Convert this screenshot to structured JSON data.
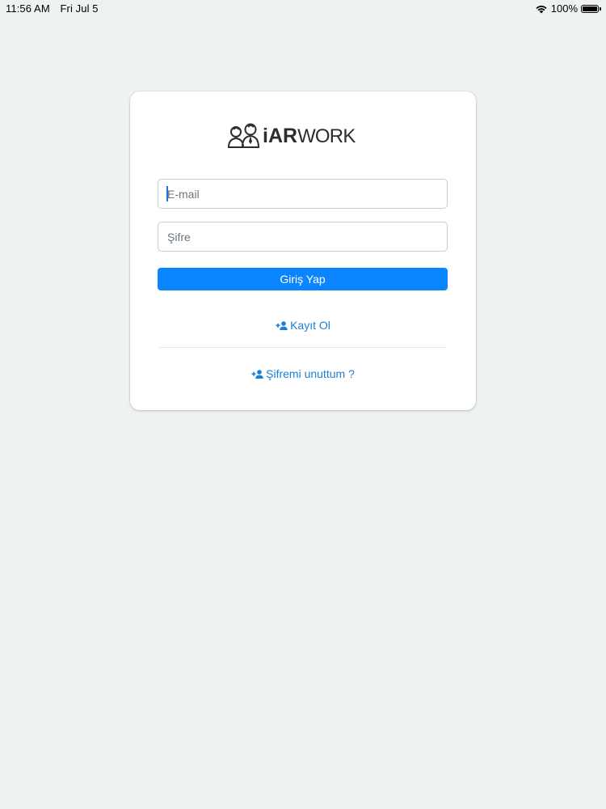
{
  "status_bar": {
    "time": "11:56 AM",
    "date": "Fri Jul 5",
    "battery": "100%"
  },
  "logo": {
    "text_bold": "iAR",
    "text_light": "WORK"
  },
  "form": {
    "email_placeholder": "E-mail",
    "password_placeholder": "Şifre",
    "login_label": "Giriş Yap"
  },
  "links": {
    "register_label": "Kayıt Ol",
    "forgot_label": "Şifremi unuttum ?"
  },
  "colors": {
    "background": "#eef2f3",
    "primary": "#0a84ff",
    "link": "#1a7fd8"
  }
}
